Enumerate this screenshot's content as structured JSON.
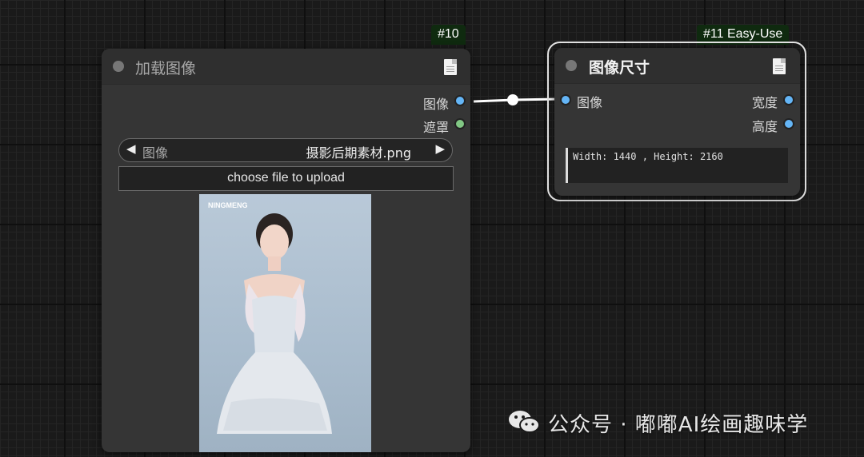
{
  "node10": {
    "badge": "#10",
    "title": "加载图像",
    "outputs": [
      {
        "label": "图像",
        "color": "#64b5f6"
      },
      {
        "label": "遮罩",
        "color": "#81c784"
      }
    ],
    "combo": {
      "label": "图像",
      "value": "摄影后期素材.png",
      "left_arrow": "◀",
      "right_arrow": "▶"
    },
    "upload_label": "choose file to upload",
    "preview_watermark": "NINGMENG"
  },
  "node11": {
    "badge": "#11 Easy-Use",
    "title": "图像尺寸",
    "input": {
      "label": "图像",
      "color": "#64b5f6"
    },
    "outputs": [
      {
        "label": "宽度",
        "color": "#64b5f6"
      },
      {
        "label": "高度",
        "color": "#64b5f6"
      }
    ],
    "info_text": "Width: 1440 , Height: 2160"
  },
  "watermark": {
    "text": "公众号 · 嘟嘟AI绘画趣味学"
  }
}
